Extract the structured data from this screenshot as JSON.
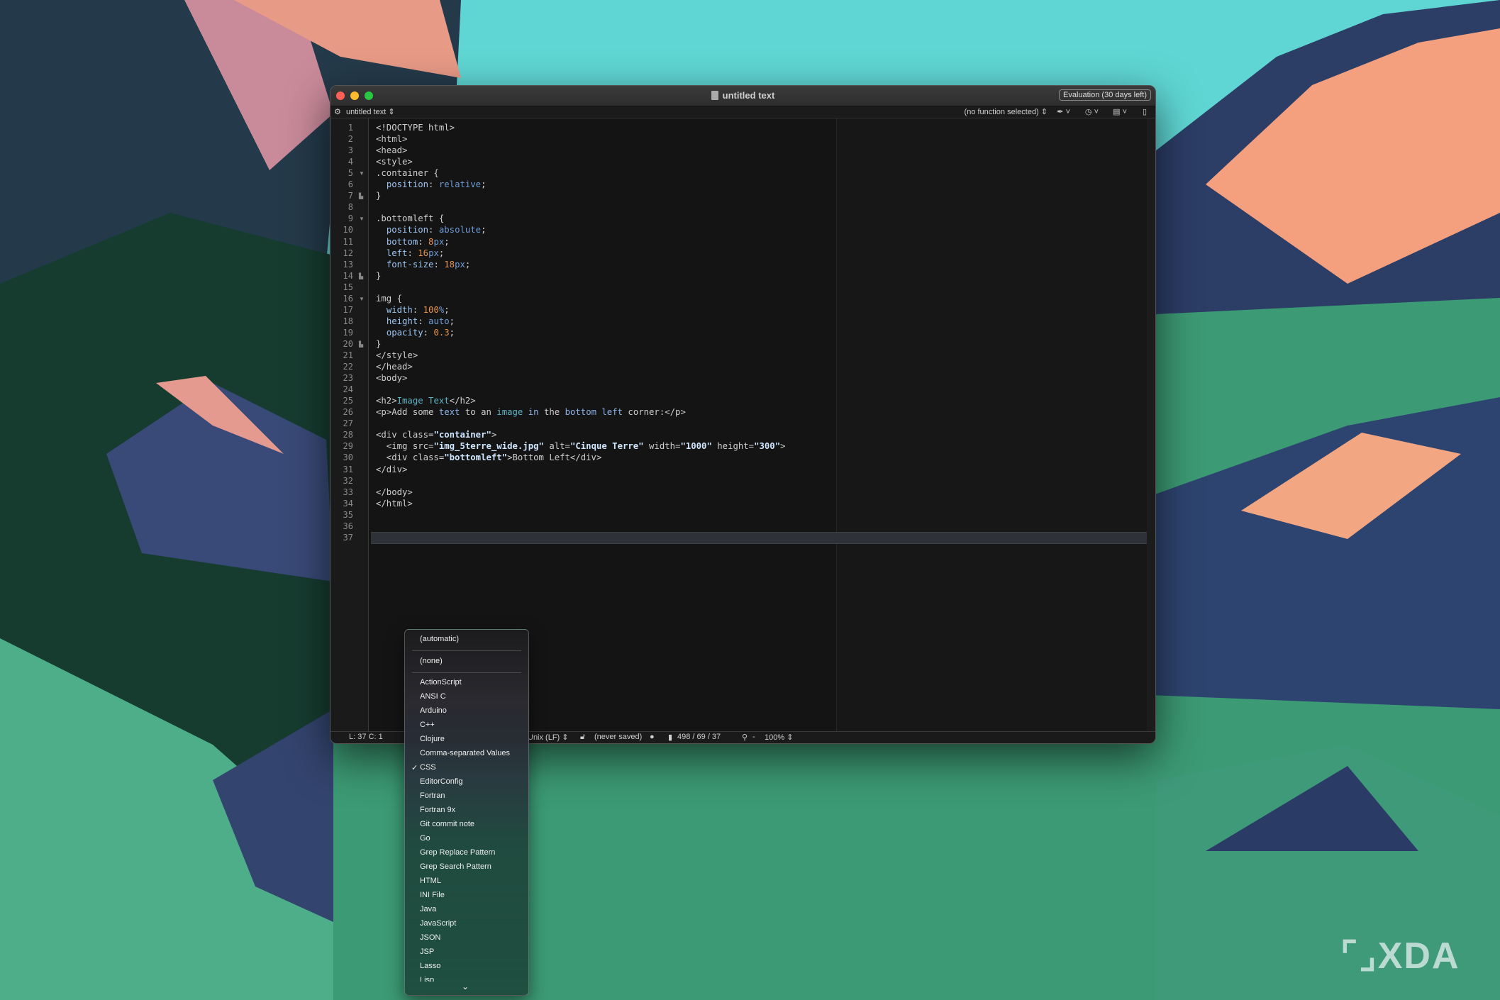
{
  "window": {
    "title": "untitled text",
    "evaluation_badge": "Evaluation (30 days left)",
    "traffic_lights": {
      "close": "#ff5f57",
      "minimize": "#febc2e",
      "zoom": "#28c840"
    }
  },
  "toolbar": {
    "document_menu": "untitled text ⇕",
    "function_menu": "(no function selected) ⇕",
    "icons": [
      "gear-icon",
      "pen-icon",
      "clock-icon",
      "document-icon"
    ]
  },
  "editor": {
    "current_line": 37,
    "lines": [
      [
        [
          "<!DOCTYPE html>",
          ""
        ]
      ],
      [
        [
          "<html>",
          ""
        ]
      ],
      [
        [
          "<head>",
          ""
        ]
      ],
      [
        [
          "<style>",
          ""
        ]
      ],
      [
        [
          ".container {",
          ""
        ]
      ],
      [
        [
          "  ",
          ""
        ],
        [
          "position",
          "k"
        ],
        [
          ": ",
          ""
        ],
        [
          "relative",
          "v"
        ],
        [
          ";",
          ""
        ]
      ],
      [
        [
          "}",
          ""
        ]
      ],
      [],
      [
        [
          ".bottomleft {",
          ""
        ]
      ],
      [
        [
          "  ",
          ""
        ],
        [
          "position",
          "k"
        ],
        [
          ": ",
          ""
        ],
        [
          "absolute",
          "v"
        ],
        [
          ";",
          ""
        ]
      ],
      [
        [
          "  ",
          ""
        ],
        [
          "bottom",
          "k"
        ],
        [
          ": ",
          ""
        ],
        [
          "8",
          "n"
        ],
        [
          "px",
          "u"
        ],
        [
          ";",
          ""
        ]
      ],
      [
        [
          "  ",
          ""
        ],
        [
          "left",
          "k"
        ],
        [
          ": ",
          ""
        ],
        [
          "16",
          "n"
        ],
        [
          "px",
          "u"
        ],
        [
          ";",
          ""
        ]
      ],
      [
        [
          "  ",
          ""
        ],
        [
          "font-size",
          "k"
        ],
        [
          ": ",
          ""
        ],
        [
          "18",
          "n"
        ],
        [
          "px",
          "u"
        ],
        [
          ";",
          ""
        ]
      ],
      [
        [
          "}",
          ""
        ]
      ],
      [],
      [
        [
          "img {",
          ""
        ]
      ],
      [
        [
          "  ",
          ""
        ],
        [
          "width",
          "k"
        ],
        [
          ": ",
          ""
        ],
        [
          "100",
          "n"
        ],
        [
          "%",
          "u"
        ],
        [
          ";",
          ""
        ]
      ],
      [
        [
          "  ",
          ""
        ],
        [
          "height",
          "k"
        ],
        [
          ": ",
          ""
        ],
        [
          "auto",
          "v"
        ],
        [
          ";",
          ""
        ]
      ],
      [
        [
          "  ",
          ""
        ],
        [
          "opacity",
          "k"
        ],
        [
          ": ",
          ""
        ],
        [
          "0.3",
          "n"
        ],
        [
          ";",
          ""
        ]
      ],
      [
        [
          "}",
          ""
        ]
      ],
      [
        [
          "</style>",
          ""
        ]
      ],
      [
        [
          "</head>",
          ""
        ]
      ],
      [
        [
          "<body>",
          ""
        ]
      ],
      [],
      [
        [
          "<h2>",
          ""
        ],
        [
          "Image Text",
          "t"
        ],
        [
          "</h2>",
          ""
        ]
      ],
      [
        [
          "<p>Add some ",
          ""
        ],
        [
          "text",
          "b"
        ],
        [
          " to an ",
          ""
        ],
        [
          "image",
          "t"
        ],
        [
          " ",
          ""
        ],
        [
          "in",
          "b"
        ],
        [
          " the ",
          ""
        ],
        [
          "bottom left",
          "b"
        ],
        [
          " corner:</p>",
          ""
        ]
      ],
      [],
      [
        [
          "<div class=",
          ""
        ],
        [
          "\"container\"",
          "s"
        ],
        [
          ">",
          ""
        ]
      ],
      [
        [
          "  <img src=",
          ""
        ],
        [
          "\"img_5terre_wide.jpg\"",
          "s"
        ],
        [
          " alt=",
          ""
        ],
        [
          "\"Cinque Terre\"",
          "s"
        ],
        [
          " width=",
          ""
        ],
        [
          "\"1000\"",
          "s"
        ],
        [
          " height=",
          ""
        ],
        [
          "\"300\"",
          "s"
        ],
        [
          ">",
          ""
        ]
      ],
      [
        [
          "  <div class=",
          ""
        ],
        [
          "\"bottomleft\"",
          "s"
        ],
        [
          ">Bottom Left</div>",
          ""
        ]
      ],
      [
        [
          "</div>",
          ""
        ]
      ],
      [],
      [
        [
          "</body>",
          ""
        ]
      ],
      [
        [
          "</html>",
          ""
        ]
      ],
      [],
      [],
      []
    ],
    "fold_open_lines": [
      5,
      9,
      16
    ],
    "fold_close_lines": [
      7,
      14,
      20
    ]
  },
  "status_bar": {
    "position": "L: 37 C: 1",
    "line_endings": "Unix (LF) ⇕",
    "save_state": "(never saved)",
    "counts": "498 / 69 / 37",
    "zoom_minus": "-",
    "zoom": "100% ⇕"
  },
  "language_menu": {
    "top_items": [
      "(automatic)",
      "(none)"
    ],
    "items": [
      "ActionScript",
      "ANSI C",
      "Arduino",
      "C++",
      "Clojure",
      "Comma-separated Values",
      "CSS",
      "EditorConfig",
      "Fortran",
      "Fortran 9x",
      "Git commit note",
      "Go",
      "Grep Replace Pattern",
      "Grep Search Pattern",
      "HTML",
      "INI File",
      "Java",
      "JavaScript",
      "JSON",
      "JSP",
      "Lasso",
      "Lisp"
    ],
    "selected": "CSS",
    "check_mark": "✓",
    "more_indicator": "⌄"
  },
  "watermark": "XDA"
}
